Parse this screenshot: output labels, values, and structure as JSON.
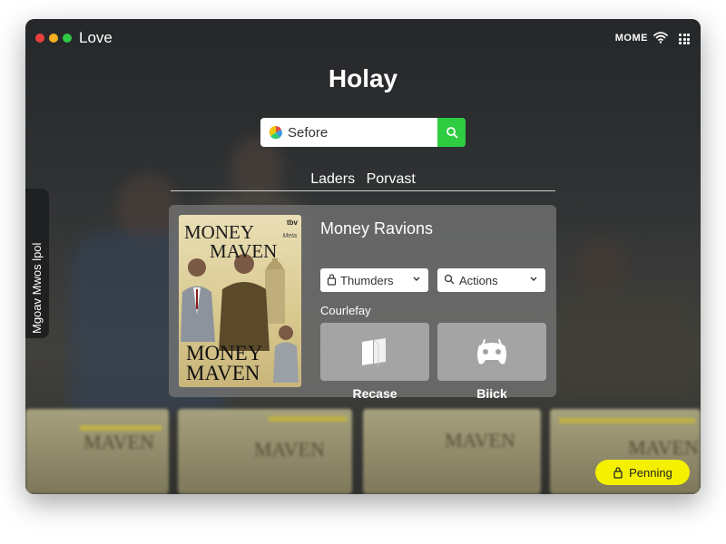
{
  "window": {
    "app_title": "Love",
    "status_text": "MOME",
    "traffic_lights": [
      "#e8403d",
      "#f5b022",
      "#2fc845"
    ]
  },
  "header": {
    "title": "Holay"
  },
  "search": {
    "value": "Sefore"
  },
  "tabs": [
    {
      "label": "Laders"
    },
    {
      "label": "Porvast"
    }
  ],
  "side_tab": {
    "label": "Mgoav Mwos lpol"
  },
  "card": {
    "title": "Money Ravions",
    "poster": {
      "title_top_line1": "MONEY",
      "title_top_line2": "MAVEN",
      "title_bottom_line1": "MONEY",
      "title_bottom_line2": "MAVEN",
      "badge": "tbv",
      "small_text": "Meta"
    },
    "dropdowns": [
      {
        "label": "Thumders",
        "icon": "lock-icon"
      },
      {
        "label": "Actions",
        "icon": "search-icon"
      }
    ],
    "section_label": "Courlefay",
    "tiles": [
      {
        "label": "Recase",
        "icon": "document-icon"
      },
      {
        "label": "Biick",
        "icon": "gamepad-icon"
      }
    ]
  },
  "thumbnails": [
    {
      "text": "MAVEN"
    },
    {
      "text": "MAVEN"
    },
    {
      "text": "MAVEN"
    },
    {
      "text": "MAVEN"
    }
  ],
  "pending_button": {
    "label": "Penning"
  },
  "colors": {
    "accent_green": "#2ecc40",
    "pending_yellow": "#f4f000"
  }
}
